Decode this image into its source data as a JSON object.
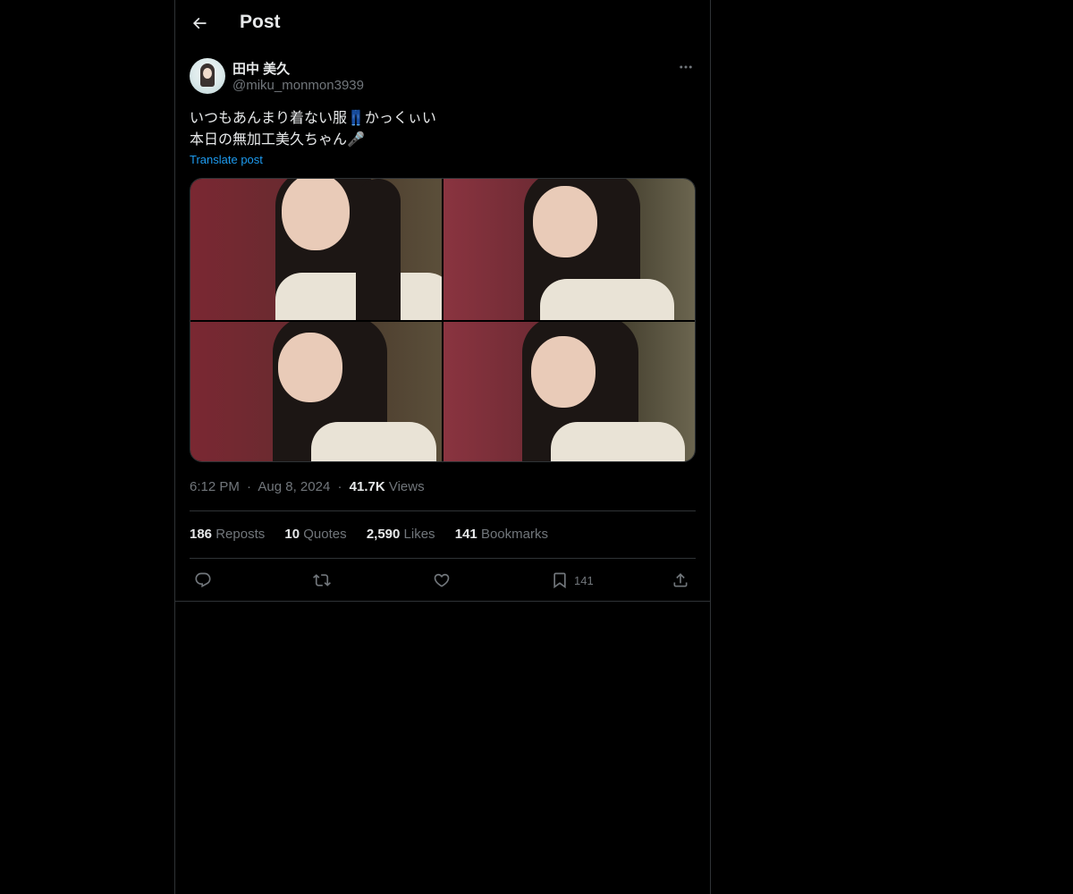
{
  "header": {
    "title": "Post",
    "back_icon": "arrow-left-icon"
  },
  "author": {
    "display_name": "田中 美久",
    "handle": "@miku_monmon3939",
    "more_icon": "more-horizontal-icon"
  },
  "post": {
    "line1": "いつもあんまり着ない服👖かっくぃい",
    "line2": "本日の無加工美久ちゃん🎤",
    "translate_label": "Translate post",
    "media": [
      {
        "alt": "photo-1"
      },
      {
        "alt": "photo-2"
      },
      {
        "alt": "photo-3"
      },
      {
        "alt": "photo-4"
      }
    ]
  },
  "meta": {
    "time": "6:12 PM",
    "separator": "·",
    "date": "Aug 8, 2024",
    "views_count": "41.7K",
    "views_label": "Views"
  },
  "stats": {
    "reposts_count": "186",
    "reposts_label": "Reposts",
    "quotes_count": "10",
    "quotes_label": "Quotes",
    "likes_count": "2,590",
    "likes_label": "Likes",
    "bookmarks_count": "141",
    "bookmarks_label": "Bookmarks"
  },
  "actions": {
    "reply_icon": "reply-icon",
    "repost_icon": "repost-icon",
    "like_icon": "heart-icon",
    "bookmark_icon": "bookmark-icon",
    "bookmark_count": "141",
    "share_icon": "share-icon"
  },
  "colors": {
    "background": "#000000",
    "text_primary": "#e7e9ea",
    "text_secondary": "#71767b",
    "link": "#1d9bf0",
    "border": "#2f3336"
  }
}
